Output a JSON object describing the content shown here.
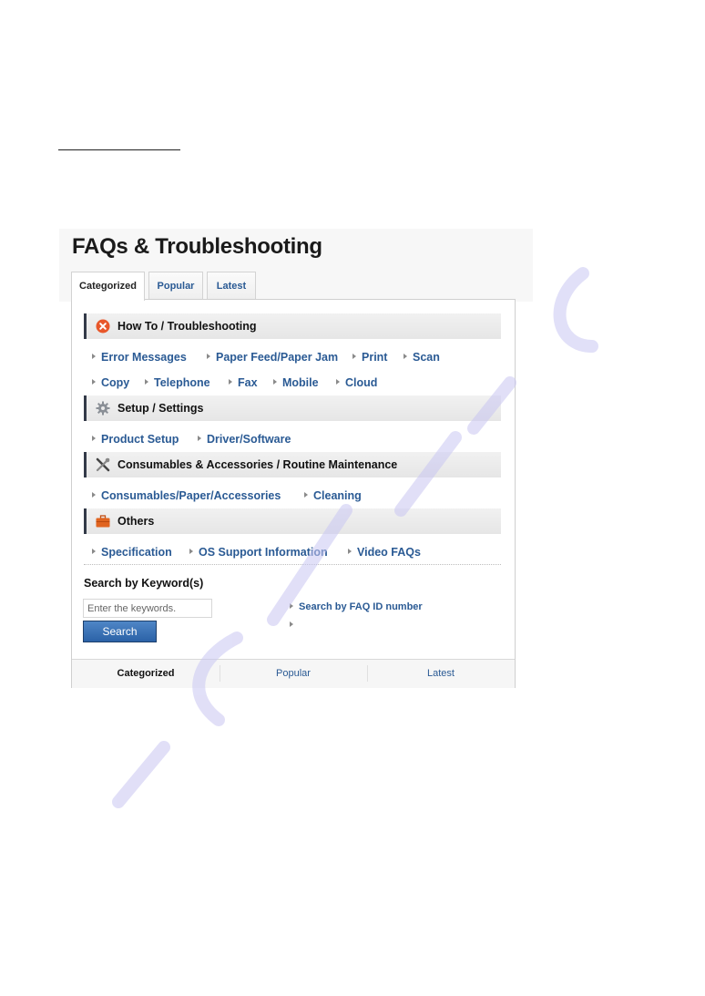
{
  "page_title": "FAQs & Troubleshooting",
  "tabs": [
    {
      "label": "Categorized",
      "active": true
    },
    {
      "label": "Popular",
      "active": false
    },
    {
      "label": "Latest",
      "active": false
    }
  ],
  "categories": [
    {
      "title": "How To / Troubleshooting",
      "icon": "error-x-icon",
      "icon_color": "#e8572a",
      "rows": [
        [
          "Error Messages",
          "Paper Feed/Paper Jam",
          "Print",
          "Scan"
        ],
        [
          "Copy",
          "Telephone",
          "Fax",
          "Mobile",
          "Cloud"
        ]
      ]
    },
    {
      "title": "Setup / Settings",
      "icon": "gear-icon",
      "icon_color": "#8a8f96",
      "rows": [
        [
          "Product Setup",
          "Driver/Software"
        ]
      ]
    },
    {
      "title": "Consumables & Accessories / Routine Maintenance",
      "icon": "tools-icon",
      "icon_color": "#555555",
      "rows": [
        [
          "Consumables/Paper/Accessories",
          "Cleaning"
        ]
      ]
    },
    {
      "title": "Others",
      "icon": "toolbox-icon",
      "icon_color": "#e06420",
      "rows": [
        [
          "Specification",
          "OS Support Information",
          "Video FAQs"
        ]
      ]
    }
  ],
  "search": {
    "title": "Search by Keyword(s)",
    "placeholder": "Enter the keywords.",
    "value": "",
    "button_label": "Search"
  },
  "side_links": [
    "Search by FAQ ID number",
    ""
  ],
  "bottom_tabs": [
    {
      "label": "Categorized",
      "active": true
    },
    {
      "label": "Popular",
      "active": false
    },
    {
      "label": "Latest",
      "active": false
    }
  ],
  "colors": {
    "link": "#2a5a94",
    "button": "#2b62a7",
    "category_bar": "#e9e9e9"
  }
}
